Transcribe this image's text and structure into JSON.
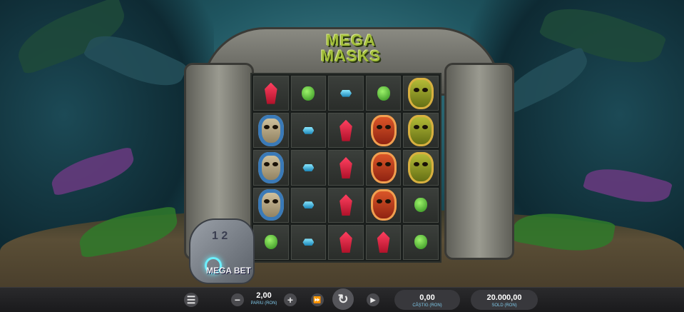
{
  "game": {
    "logo_line1": "MEGA",
    "logo_line2": "MASKS",
    "megabet_label": "MEGA BET",
    "stone_digits": "1 2"
  },
  "reels": [
    [
      "red-gem",
      "green-gem",
      "blue-gem",
      "green-gem",
      "green-mask"
    ],
    [
      "blue-mask",
      "blue-gem",
      "red-gem",
      "red-mask",
      "green-mask"
    ],
    [
      "blue-mask",
      "blue-gem",
      "red-gem",
      "red-mask",
      "green-mask"
    ],
    [
      "blue-mask",
      "blue-gem",
      "red-gem",
      "red-mask",
      "green-gem"
    ],
    [
      "green-gem",
      "blue-gem",
      "red-gem",
      "red-gem",
      "green-gem"
    ]
  ],
  "controls": {
    "menu_icon": "menu-icon",
    "minus_icon": "minus-icon",
    "plus_icon": "plus-icon",
    "turbo_icon": "fast-forward-icon",
    "spin_icon": "spin-icon",
    "autoplay_icon": "play-icon",
    "bet_value": "2,00",
    "bet_label": "PARIU (RON)",
    "win_value": "0,00",
    "win_label": "CÂȘTIG (RON)",
    "balance_value": "20.000,00",
    "balance_label": "SOLD (RON)"
  },
  "colors": {
    "accent_label": "#7fc8e8",
    "bar_bg": "#1a1a1c",
    "logo_green": "#a3bf3a"
  }
}
